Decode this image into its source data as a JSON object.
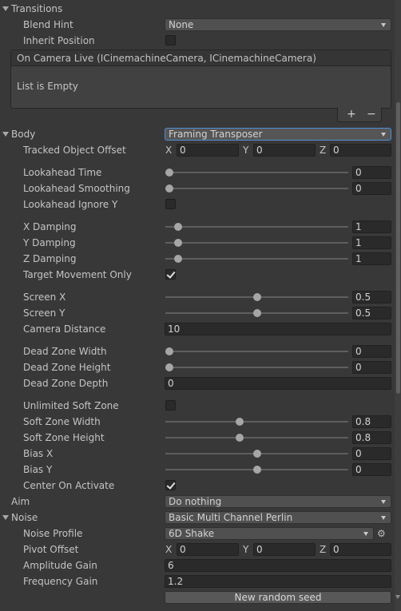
{
  "transitions": {
    "header": "Transitions",
    "blend_hint": {
      "label": "Blend Hint",
      "value": "None"
    },
    "inherit_position": {
      "label": "Inherit Position",
      "checked": false
    },
    "list": {
      "header": "On Camera Live (ICinemachineCamera, ICinemachineCamera)",
      "empty_text": "List is Empty",
      "add": "+",
      "remove": "−"
    }
  },
  "body": {
    "header": "Body",
    "mode": "Framing Transposer",
    "tracked_object_offset": {
      "label": "Tracked Object Offset",
      "x": "0",
      "y": "0",
      "z": "0"
    },
    "lookahead_time": {
      "label": "Lookahead Time",
      "value": "0",
      "fraction": 0
    },
    "lookahead_smoothing": {
      "label": "Lookahead Smoothing",
      "value": "0",
      "fraction": 0
    },
    "lookahead_ignore_y": {
      "label": "Lookahead Ignore Y",
      "checked": false
    },
    "x_damping": {
      "label": "X Damping",
      "value": "1",
      "fraction": 0.05
    },
    "y_damping": {
      "label": "Y Damping",
      "value": "1",
      "fraction": 0.05
    },
    "z_damping": {
      "label": "Z Damping",
      "value": "1",
      "fraction": 0.05
    },
    "target_movement_only": {
      "label": "Target Movement Only",
      "checked": true
    },
    "screen_x": {
      "label": "Screen X",
      "value": "0.5",
      "fraction": 0.5
    },
    "screen_y": {
      "label": "Screen Y",
      "value": "0.5",
      "fraction": 0.5
    },
    "camera_distance": {
      "label": "Camera Distance",
      "value": "10"
    },
    "dead_zone_width": {
      "label": "Dead Zone Width",
      "value": "0",
      "fraction": 0
    },
    "dead_zone_height": {
      "label": "Dead Zone Height",
      "value": "0",
      "fraction": 0
    },
    "dead_zone_depth": {
      "label": "Dead Zone Depth",
      "value": "0"
    },
    "unlimited_soft_zone": {
      "label": "Unlimited Soft Zone",
      "checked": false
    },
    "soft_zone_width": {
      "label": "Soft Zone Width",
      "value": "0.8",
      "fraction": 0.4
    },
    "soft_zone_height": {
      "label": "Soft Zone Height",
      "value": "0.8",
      "fraction": 0.4
    },
    "bias_x": {
      "label": "Bias X",
      "value": "0",
      "fraction": 0.5
    },
    "bias_y": {
      "label": "Bias Y",
      "value": "0",
      "fraction": 0.5
    },
    "center_on_activate": {
      "label": "Center On Activate",
      "checked": true
    }
  },
  "aim": {
    "header": "Aim",
    "value": "Do nothing"
  },
  "noise": {
    "header": "Noise",
    "value": "Basic Multi Channel Perlin",
    "noise_profile": {
      "label": "Noise Profile",
      "value": "6D Shake",
      "icon": "gear-icon"
    },
    "pivot_offset": {
      "label": "Pivot Offset",
      "x": "0",
      "y": "0",
      "z": "0"
    },
    "amplitude_gain": {
      "label": "Amplitude Gain",
      "value": "6"
    },
    "frequency_gain": {
      "label": "Frequency Gain",
      "value": "1.2"
    },
    "new_random_seed": "New random seed"
  },
  "axis_letters": {
    "x": "X",
    "y": "Y",
    "z": "Z"
  }
}
